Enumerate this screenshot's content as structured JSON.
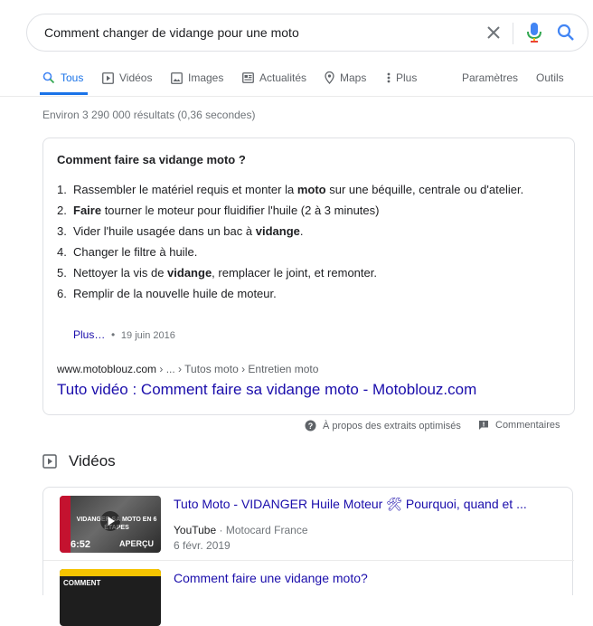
{
  "search": {
    "query": "Comment changer de vidange pour une moto"
  },
  "tabs": {
    "items": [
      {
        "label": "Tous"
      },
      {
        "label": "Vidéos"
      },
      {
        "label": "Images"
      },
      {
        "label": "Actualités"
      },
      {
        "label": "Maps"
      },
      {
        "label": "Plus"
      }
    ],
    "settings": "Paramètres",
    "tools": "Outils"
  },
  "stats": "Environ 3 290 000 résultats (0,36 secondes)",
  "snippet": {
    "title": "Comment faire sa vidange moto ?",
    "steps": [
      {
        "num": "1.",
        "parts": [
          "Rassembler le matériel requis et monter la ",
          "moto",
          " sur une béquille, centrale ou d'atelier."
        ]
      },
      {
        "num": "2.",
        "parts": [
          "",
          "Faire",
          " tourner le moteur pour fluidifier l'huile (2 à 3 minutes)"
        ]
      },
      {
        "num": "3.",
        "parts": [
          "Vider l'huile usagée dans un bac à ",
          "vidange",
          "."
        ]
      },
      {
        "num": "4.",
        "parts": [
          "Changer le filtre à huile.",
          "",
          ""
        ]
      },
      {
        "num": "5.",
        "parts": [
          "Nettoyer la vis de ",
          "vidange",
          ", remplacer le joint, et remonter."
        ]
      },
      {
        "num": "6.",
        "parts": [
          "Remplir de la nouvelle huile de moteur.",
          "",
          ""
        ]
      }
    ],
    "more": "Plus…",
    "date": "19 juin 2016",
    "site": "www.motoblouz.com",
    "path": " › ... › Tutos moto › Entretien moto",
    "link": "Tuto vidéo : Comment faire sa vidange moto - Motoblouz.com"
  },
  "snippet_footer": {
    "about": "À propos des extraits optimisés",
    "feedback": "Commentaires"
  },
  "videos": {
    "heading": "Vidéos",
    "items": [
      {
        "title": "Tuto Moto - VIDANGER Huile Moteur 🛠 Pourquoi, quand et ...",
        "source": "YouTube",
        "channel": "Motocard France",
        "date": "6 févr. 2019",
        "duration": "6:52",
        "preview": "APERÇU",
        "thumb_text": "VIDANGER SA MOTO EN 6 ÉTAPES"
      },
      {
        "title": "Comment faire une vidange moto?",
        "thumb_text": "COMMENT"
      }
    ]
  },
  "colors": {
    "link": "#1a0dab",
    "accent": "#1a73e8",
    "muted": "#70757a"
  }
}
